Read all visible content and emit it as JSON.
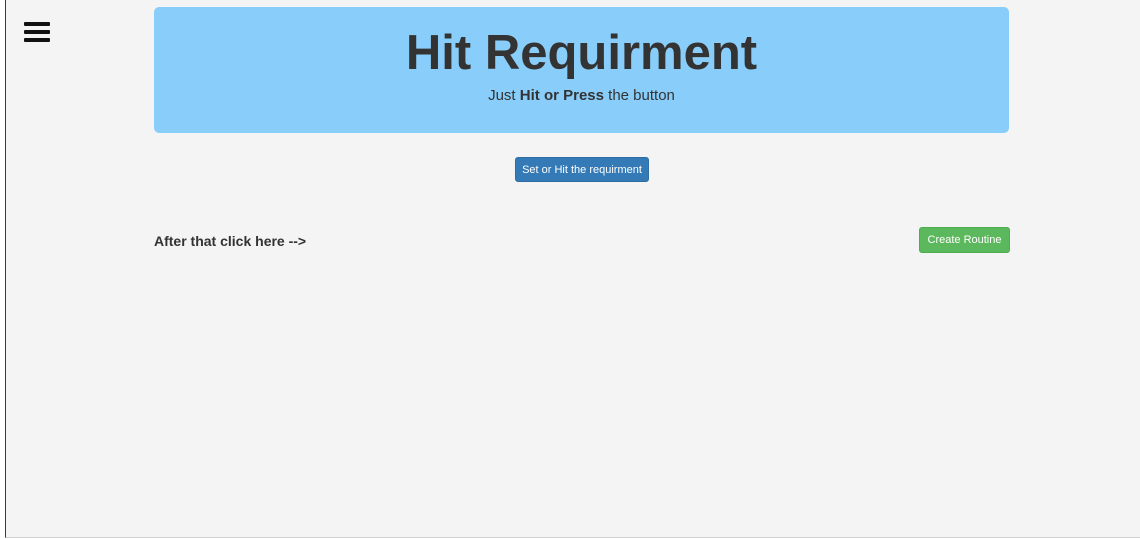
{
  "nav": {
    "menu_icon": "hamburger-menu-icon"
  },
  "jumbotron": {
    "title": "Hit Requirment",
    "subtitle_prefix": "Just ",
    "subtitle_bold": "Hit or Press",
    "subtitle_suffix": " the button",
    "background_color": "#89cefa"
  },
  "actions": {
    "set_hit_label": "Set or Hit the requirment",
    "after_text": "After that click here -->",
    "create_routine_label": "Create Routine"
  },
  "colors": {
    "primary": "#337ab7",
    "success": "#5cb85c",
    "page_background": "#f4f4f4"
  }
}
